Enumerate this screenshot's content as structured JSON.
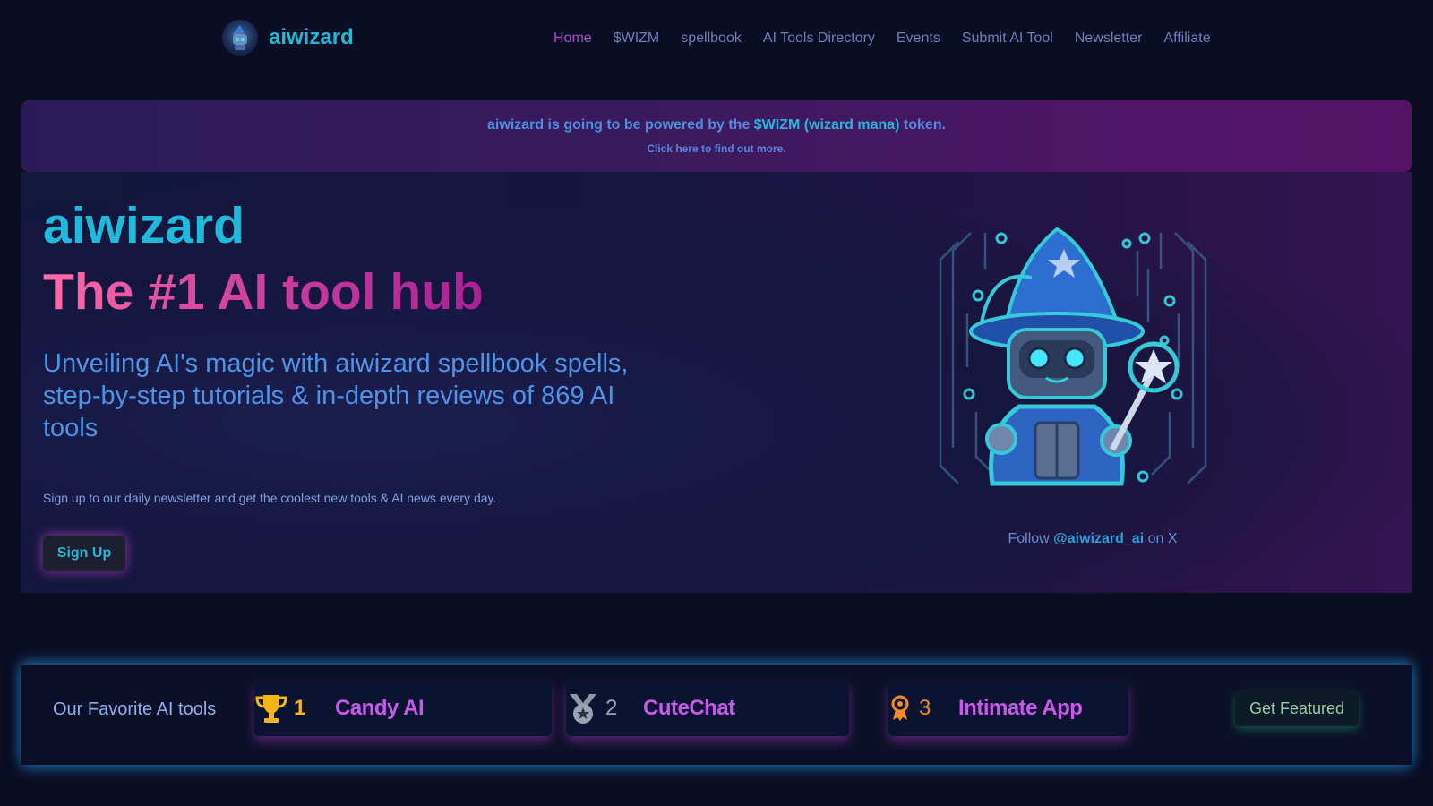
{
  "brand": {
    "name": "aiwizard"
  },
  "nav": {
    "items": [
      {
        "label": "Home",
        "active": true
      },
      {
        "label": "$WIZM"
      },
      {
        "label": "spellbook"
      },
      {
        "label": "AI Tools Directory"
      },
      {
        "label": "Events"
      },
      {
        "label": "Submit AI Tool"
      },
      {
        "label": "Newsletter"
      },
      {
        "label": "Affiliate"
      }
    ]
  },
  "banner": {
    "text_before": "aiwizard is going to be powered by the ",
    "token": "$WIZM (wizard mana)",
    "text_after": " token.",
    "link": "Click here to find out more."
  },
  "hero": {
    "title": "aiwizard",
    "subtitle": "The #1 AI tool hub",
    "description": "Unveiling AI's magic with aiwizard spellbook spells, step-by-step tutorials & in-depth reviews of 869 AI tools",
    "newsletter_text": "Sign up to our daily newsletter and get the coolest new tools & AI news every day.",
    "signup_label": "Sign Up",
    "follow_prefix": "Follow ",
    "follow_handle": "@aiwizard_ai",
    "follow_suffix": " on X"
  },
  "favorites": {
    "label": "Our Favorite AI tools",
    "items": [
      {
        "rank": "1",
        "name": "Candy AI",
        "icon": "trophy-icon",
        "rank_color": "#f5b417"
      },
      {
        "rank": "2",
        "name": "CuteChat",
        "icon": "silver-medal-icon",
        "rank_color": "#9aa3b5"
      },
      {
        "rank": "3",
        "name": "Intimate App",
        "icon": "bronze-award-icon",
        "rank_color": "#f08a2c"
      }
    ],
    "get_featured_label": "Get Featured"
  },
  "colors": {
    "accent_cyan": "#1fbadb",
    "accent_pink": "#ff6aa8",
    "accent_purple": "#c55ae8",
    "background": "#0b0d24"
  }
}
